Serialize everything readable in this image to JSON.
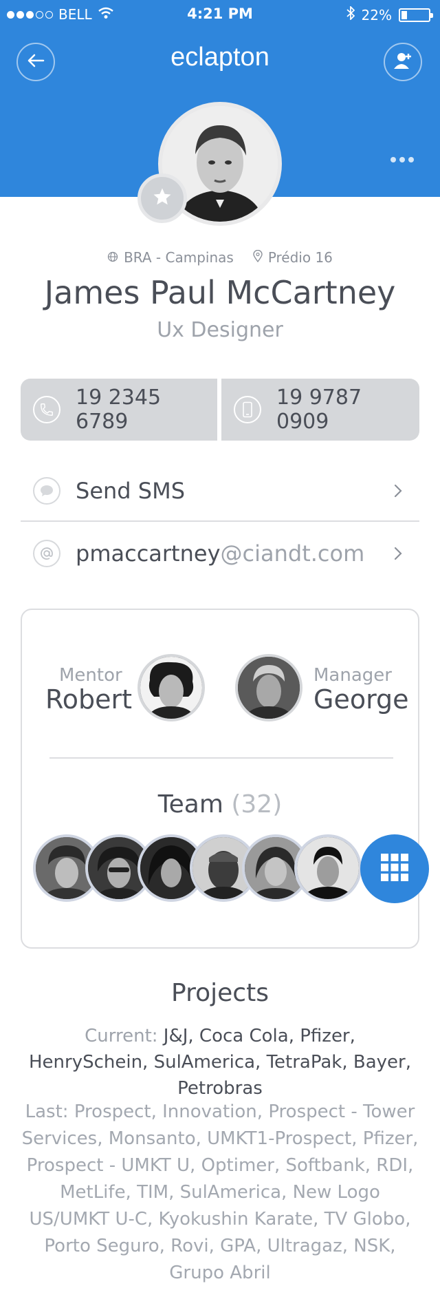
{
  "status_bar": {
    "carrier": "BELL",
    "time": "4:21 PM",
    "battery": "22%",
    "battery_level": 0.22,
    "signal_bars_filled": 3,
    "signal_bars_total": 5
  },
  "header": {
    "title": "eclapton",
    "background_color": "#2f86dc"
  },
  "profile": {
    "location": "BRA - Campinas",
    "building": "Prédio 16",
    "name": "James Paul McCartney",
    "job_title": "Ux Designer"
  },
  "phones": {
    "landline": "19 2345 6789",
    "mobile": "19 9787 0909"
  },
  "actions": {
    "sms_label": "Send SMS",
    "email_user": "pmaccartney",
    "email_domain": "@ciandt.com"
  },
  "relations": {
    "mentor_label": "Mentor",
    "mentor_name": "Robert",
    "manager_label": "Manager",
    "manager_name": "George"
  },
  "team": {
    "label": "Team",
    "count": "(32)"
  },
  "projects": {
    "title": "Projects",
    "current_label": "Current:",
    "current_list": "J&J, Coca Cola, Pfizer, HenrySchein, SulAmerica, TetraPak, Bayer, Petrobras",
    "last_text": "Last: Prospect, Innovation, Prospect - Tower Services, Monsanto, UMKT1-Prospect, Pfizer, Prospect - UMKT U, Optimer, Softbank, RDI, MetLife, TIM, SulAmerica, New Logo US/UMKT U-C, Kyokushin Karate, TV Globo, Porto Seguro, Rovi, GPA, Ultragaz, NSK, Grupo Abril"
  },
  "icons": {
    "back": "arrow-left-icon",
    "add_user": "add-user-icon",
    "more": "more-dots-icon",
    "star": "star-icon",
    "globe": "globe-icon",
    "pin": "map-pin-icon",
    "phone": "phone-icon",
    "mobile": "mobile-phone-icon",
    "sms": "chat-bubble-icon",
    "email": "at-sign-icon",
    "chevron": "chevron-right-icon",
    "grid": "grid-icon"
  }
}
